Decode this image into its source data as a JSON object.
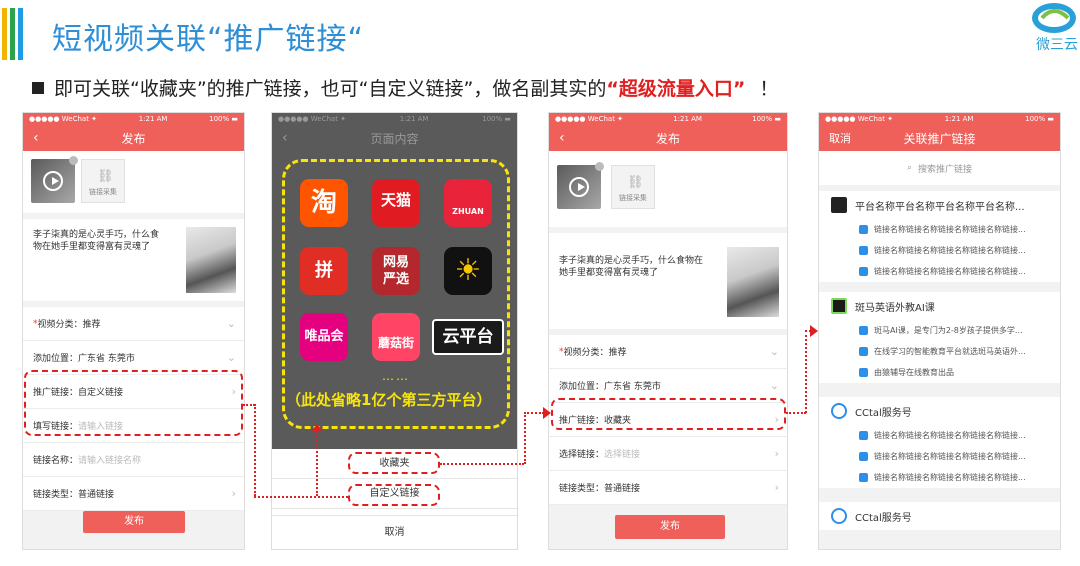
{
  "title": "短视频关联“推广链接“",
  "subtitle": {
    "pre": "即可关联“收藏夹”的推广链接，也可“自定义链接”，做名副其实的",
    "hl": "“超级流量入口”",
    "post": "！"
  },
  "logo_text": "微三云",
  "status": {
    "left": "●●●●● WeChat ✦",
    "time": "1:21 AM",
    "right": "100% ▬"
  },
  "colors": {
    "accent": "#f0605a",
    "title": "#2e8ed6",
    "highlight": "#e02020",
    "dash_yellow": "#f7e50a"
  },
  "phone1": {
    "nav_title": "发布",
    "back": "‹",
    "link_collect": "链接采集",
    "desc": "李子柒真的是心灵手巧，什么食物在她手里都变得富有灵魂了",
    "rows": [
      {
        "label": "视频分类",
        "value": "推荐",
        "req": "*"
      },
      {
        "label": "添加位置",
        "value": "广东省 东莞市"
      },
      {
        "label": "推广链接",
        "value": "自定义链接"
      },
      {
        "label": "填写链接",
        "placeholder": "请输入链接"
      },
      {
        "label": "链接名称",
        "placeholder": "请输入链接名称"
      },
      {
        "label": "链接类型",
        "value": "普通链接"
      }
    ],
    "publish": "发布"
  },
  "phone2": {
    "nav_title": "页面内容",
    "back": "‹",
    "apps": [
      {
        "name": "淘",
        "color": "#ff5500"
      },
      {
        "name": "天猫",
        "color": "#e01b22"
      },
      {
        "name": "ZHUAN",
        "color": "#e8233a"
      },
      {
        "name": "拼",
        "color": "#e02e24"
      },
      {
        "name": "网易\n严选",
        "color": "#b4282d"
      },
      {
        "name": "☀",
        "color": "#111"
      },
      {
        "name": "唯品会",
        "color": "#e4007f"
      },
      {
        "name": "蘑菇街",
        "color": "#ff4466"
      },
      {
        "name": "云平台",
        "color": "#1a1a1a"
      }
    ],
    "dots": "……",
    "omit": "（此处省略1亿个第三方平台）",
    "options": [
      "收藏夹",
      "自定义链接"
    ],
    "cancel": "取消"
  },
  "phone3": {
    "nav_title": "发布",
    "back": "‹",
    "link_collect": "链接采集",
    "desc": "李子柒真的是心灵手巧，什么食物在她手里都变得富有灵魂了",
    "rows": [
      {
        "label": "视频分类",
        "value": "推荐",
        "req": "*"
      },
      {
        "label": "添加位置",
        "value": "广东省 东莞市"
      },
      {
        "label": "推广链接",
        "value": "收藏夹"
      },
      {
        "label": "选择链接",
        "placeholder": "选择链接"
      },
      {
        "label": "链接类型",
        "value": "普通链接"
      }
    ],
    "publish": "发布"
  },
  "phone4": {
    "nav_title": "关联推广链接",
    "cancel": "取消",
    "search": "搜索推广链接",
    "groups": [
      {
        "name": "平台名称平台名称平台名称平台名称...",
        "items": [
          "链接名称链接名称链接名称链接名称链接...",
          "链接名称链接名称链接名称链接名称链接...",
          "链接名称链接名称链接名称链接名称链接..."
        ]
      },
      {
        "name": "斑马英语外教AI课",
        "items": [
          "斑马AI课，是专门为2-8岁孩子提供多学...",
          "在线学习的智能教育平台就选斑马英语外...",
          "由猿辅导在线教育出品"
        ]
      },
      {
        "name": "CCtal服务号",
        "items": [
          "链接名称链接名称链接名称链接名称链接...",
          "链接名称链接名称链接名称链接名称链接...",
          "链接名称链接名称链接名称链接名称链接..."
        ]
      },
      {
        "name": "CCtal服务号",
        "items": []
      }
    ]
  }
}
